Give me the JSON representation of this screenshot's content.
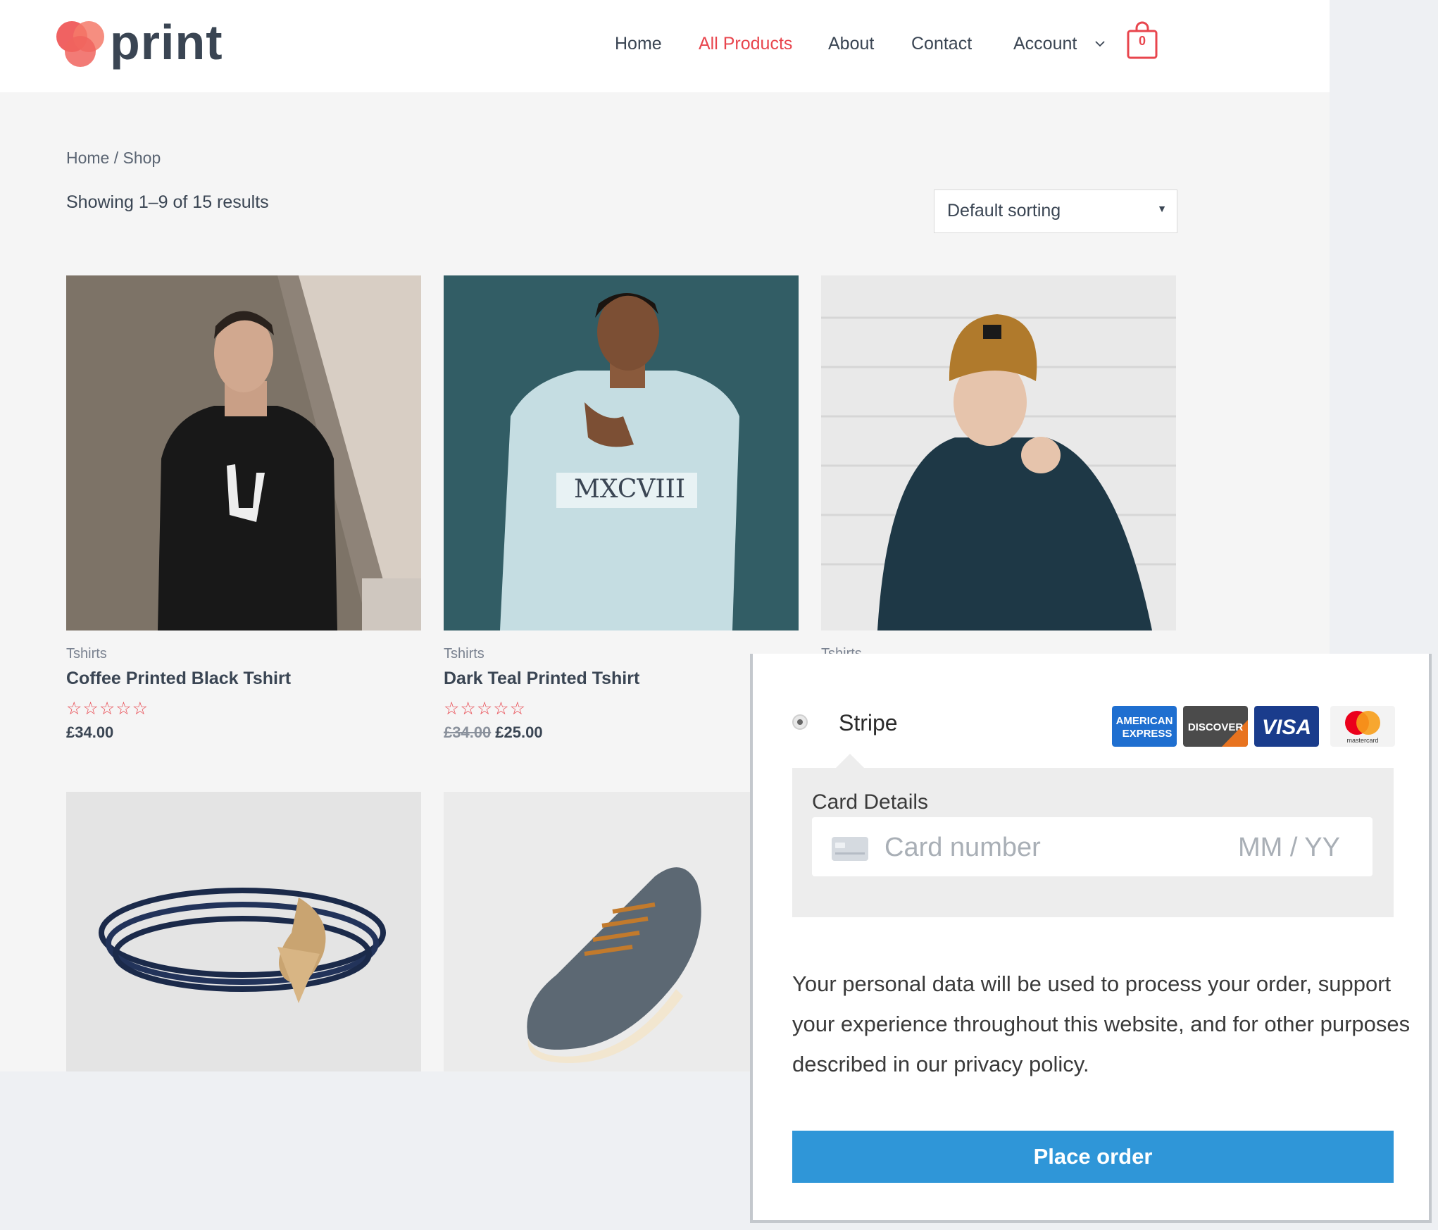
{
  "logo": {
    "text": "print"
  },
  "nav": {
    "items": [
      "Home",
      "All Products",
      "About",
      "Contact",
      "Account"
    ],
    "active_index": 1,
    "cart_count": "0"
  },
  "colors": {
    "accent": "#e8454d",
    "text_dark": "#3a4553",
    "button_blue": "#2f96d8",
    "page_bg": "#f5f5f5"
  },
  "breadcrumb": {
    "home": "Home",
    "separator": "/",
    "current": "Shop"
  },
  "results": "Showing 1–9 of 15 results",
  "sort": {
    "selected": "Default sorting"
  },
  "products": [
    {
      "category": "Tshirts",
      "title": "Coffee Printed Black Tshirt",
      "rating": 0,
      "price": "£34.00",
      "old_price": ""
    },
    {
      "category": "Tshirts",
      "title": "Dark Teal Printed Tshirt",
      "rating": 0,
      "price": "£25.00",
      "old_price": "£34.00"
    },
    {
      "category": "Tshirts"
    },
    {
      "image": "bracelet"
    },
    {
      "image": "shoe"
    }
  ],
  "payment": {
    "method": "Stripe",
    "card_brands": [
      {
        "name": "AMERICAN EXPRESS",
        "line1": "AMERICAN",
        "line2": "EXPRESS"
      },
      {
        "name": "DISCOVER"
      },
      {
        "name": "VISA"
      },
      {
        "name": "mastercard"
      }
    ],
    "card_details_label": "Card Details",
    "card_number_placeholder": "Card number",
    "expiry_placeholder": "MM / YY",
    "privacy_text": "Your personal data will be used to process your order, support your experience throughout this website, and for other purposes described in our ",
    "privacy_link": "privacy policy",
    "privacy_end": ".",
    "place_order": "Place order"
  }
}
